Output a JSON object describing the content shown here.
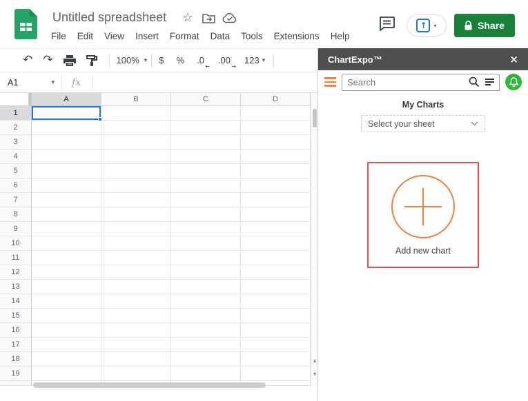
{
  "titlebar": {
    "title": "Untitled spreadsheet",
    "share_label": "Share"
  },
  "menu": {
    "items": [
      "File",
      "Edit",
      "View",
      "Insert",
      "Format",
      "Data",
      "Tools",
      "Extensions",
      "Help"
    ]
  },
  "toolbar": {
    "zoom_value": "100%",
    "currency": "$",
    "percent": "%",
    "decrease_decimal": ".0",
    "increase_decimal": ".00",
    "number_format": "123"
  },
  "formula_bar": {
    "cell_reference": "A1",
    "fx_label": "fx"
  },
  "grid": {
    "column_headers": [
      "A",
      "B",
      "C",
      "D"
    ],
    "row_numbers": [
      1,
      2,
      3,
      4,
      5,
      6,
      7,
      8,
      9,
      10,
      11,
      12,
      13,
      14,
      15,
      16,
      17,
      18,
      19
    ],
    "selected_cell": "A1",
    "selected_column": "A",
    "selected_row": 1
  },
  "sidebar": {
    "title": "ChartExpo™",
    "search_placeholder": "Search",
    "my_charts_title": "My Charts",
    "sheet_selector_label": "Select your sheet",
    "add_chart_label": "Add new chart"
  },
  "icons": {
    "star": "☆",
    "undo": "↶",
    "redo": "↷",
    "caret_down": "▾",
    "present_arrow": "↑",
    "close": "×",
    "scroll_up": "▲",
    "scroll_down": "▼",
    "dec_left_arrow": "←",
    "dec_right_arrow": "→"
  },
  "colors": {
    "brand_green": "#23A566",
    "share_button_green": "#188038",
    "selection_blue": "#1A73E8",
    "chartexpo_orange": "#E8823E",
    "add_chart_border_red": "#D9534F",
    "sidebar_header_gray": "#4F4F4F",
    "bell_green": "#2EB83C"
  }
}
